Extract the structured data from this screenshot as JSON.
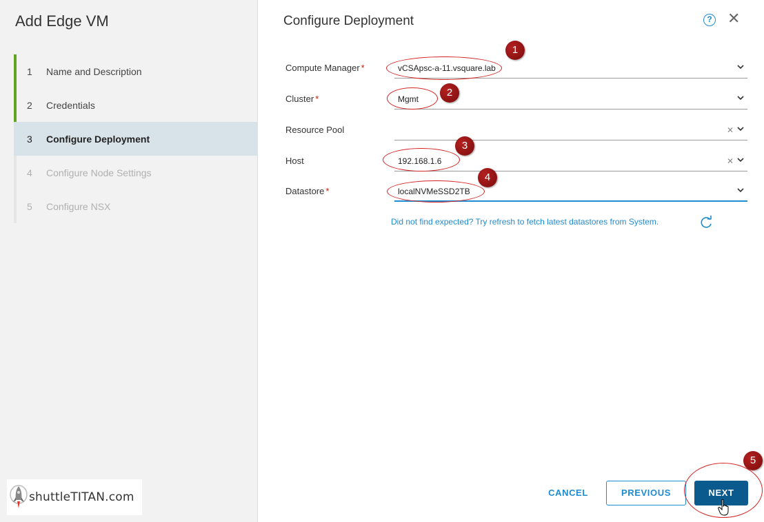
{
  "wizard": {
    "title": "Add Edge VM",
    "steps": [
      {
        "num": "1",
        "label": "Name and Description",
        "state": "done"
      },
      {
        "num": "2",
        "label": "Credentials",
        "state": "done"
      },
      {
        "num": "3",
        "label": "Configure Deployment",
        "state": "active"
      },
      {
        "num": "4",
        "label": "Configure Node Settings",
        "state": "disabled"
      },
      {
        "num": "5",
        "label": "Configure NSX",
        "state": "disabled"
      }
    ]
  },
  "brand": {
    "text": "shuttleTITAN.com",
    "icon": "rocket-icon"
  },
  "page": {
    "title": "Configure Deployment",
    "help_icon": "?",
    "close_icon": "✕"
  },
  "form": {
    "compute_manager": {
      "label": "Compute Manager",
      "required": "*",
      "value": "vCSApsc-a-11.vsquare.lab"
    },
    "cluster": {
      "label": "Cluster",
      "required": "*",
      "value": "Mgmt"
    },
    "resource_pool": {
      "label": "Resource Pool",
      "value": ""
    },
    "host": {
      "label": "Host",
      "value": "192.168.1.6"
    },
    "datastore": {
      "label": "Datastore",
      "required": "*",
      "value": "localNVMeSSD2TB"
    },
    "hint": "Did not find expected? Try refresh to fetch latest datastores from System."
  },
  "annotations": [
    "1",
    "2",
    "3",
    "4",
    "5"
  ],
  "footer": {
    "cancel": "CANCEL",
    "previous": "PREVIOUS",
    "next": "NEXT"
  },
  "colors": {
    "accent": "#1f8bd0",
    "next_bg": "#0a5a8e",
    "done_bar": "#62a420",
    "active_step_bg": "#d8e3e9",
    "annotation_red": "#d62020"
  }
}
